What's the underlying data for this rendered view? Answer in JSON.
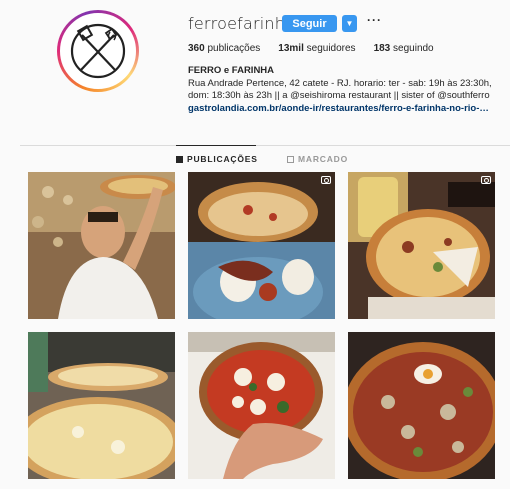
{
  "profile": {
    "username": "ferroefarinha",
    "follow_label": "Seguir",
    "dropdown_icon": "chevron-down-icon",
    "more_label": "···",
    "stats": [
      {
        "count": "360",
        "label": "publicações"
      },
      {
        "count": "13mil",
        "label": "seguidores"
      },
      {
        "count": "183",
        "label": "seguindo"
      }
    ],
    "bio_name": "FERRO e FARINHA",
    "bio_text": "Rua Andrade Pertence, 42 catete - RJ. horario: ter - sab: 19h às 23:30h, dom: 18:30h às 23h || a @seishiroma restaurant || sister of @southferro",
    "bio_link": "gastrolandia.com.br/aonde-ir/restaurantes/ferro-e-farinha-no-rio-de-janeiro"
  },
  "tabs": [
    {
      "label": "PUBLICAÇÕES",
      "icon": "grid-icon",
      "active": true
    },
    {
      "label": "MARCADO",
      "icon": "tag-icon",
      "active": false
    }
  ],
  "colors": {
    "accent": "#3897f0",
    "link": "#003569",
    "text": "#262626",
    "muted": "#999999",
    "background": "#fafafa"
  },
  "posts": [
    {
      "subject": "chef holding pizza",
      "video": false
    },
    {
      "subject": "pizza and burrata plate",
      "video": true
    },
    {
      "subject": "pizza with drink",
      "video": true
    },
    {
      "subject": "white pizzas on counter",
      "video": false
    },
    {
      "subject": "margherita pizza over hand",
      "video": false
    },
    {
      "subject": "pizza with egg and mushrooms",
      "video": false
    }
  ]
}
